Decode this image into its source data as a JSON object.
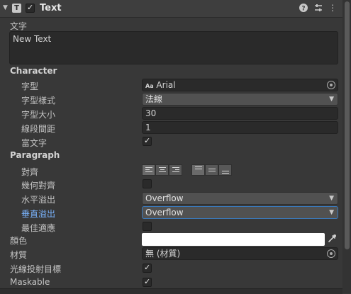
{
  "component": {
    "title": "Text"
  },
  "text_section": {
    "label": "文字",
    "value": "New Text"
  },
  "character": {
    "heading": "Character",
    "font": {
      "label": "字型",
      "prefix": "Aa",
      "value": "Arial"
    },
    "font_style": {
      "label": "字型樣式",
      "value": "法線"
    },
    "font_size": {
      "label": "字型大小",
      "value": "30"
    },
    "line_spacing": {
      "label": "線段間距",
      "value": "1"
    },
    "rich_text": {
      "label": "富文字",
      "checked": true
    }
  },
  "paragraph": {
    "heading": "Paragraph",
    "alignment": {
      "label": "對齊"
    },
    "align_by_geometry": {
      "label": "幾何對齊",
      "checked": false
    },
    "horizontal_overflow": {
      "label": "水平溢出",
      "value": "Overflow"
    },
    "vertical_overflow": {
      "label": "垂直溢出",
      "value": "Overflow"
    },
    "best_fit": {
      "label": "最佳適應",
      "checked": false
    }
  },
  "color": {
    "label": "顏色",
    "value": "#ffffff"
  },
  "material": {
    "label": "材質",
    "value": "無 (材質)"
  },
  "raycast_target": {
    "label": "光線投射目標",
    "checked": true
  },
  "maskable": {
    "label": "Maskable",
    "checked": true
  }
}
